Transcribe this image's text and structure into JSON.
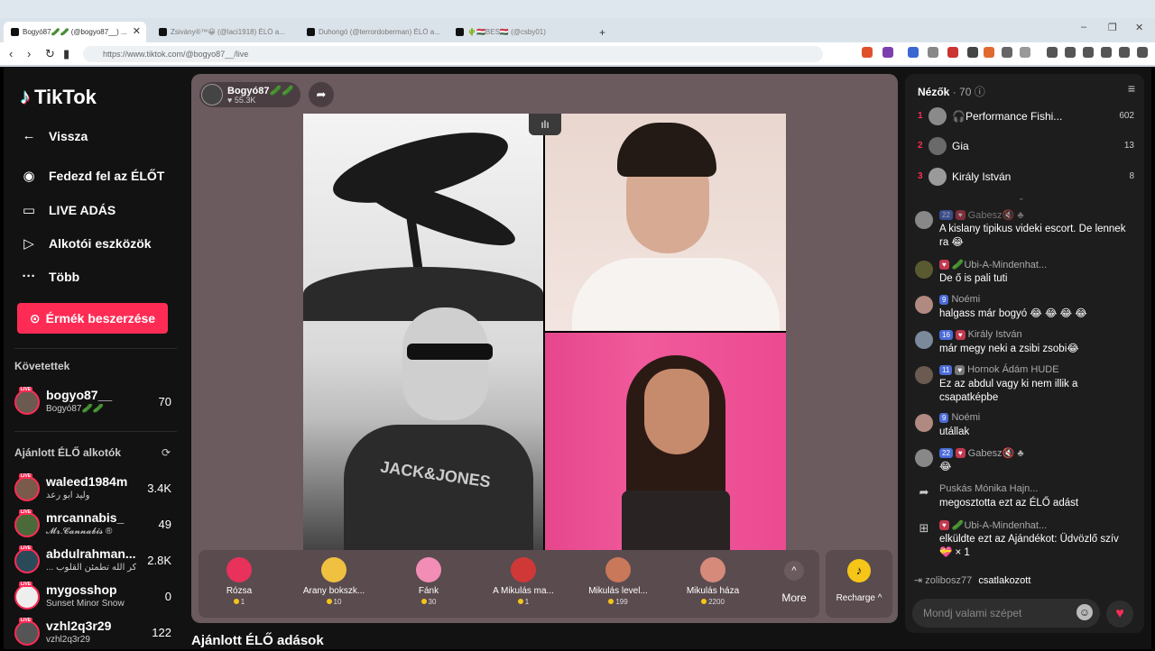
{
  "browser": {
    "tabs": [
      {
        "title": "Bogyó87🥒🥒 (@bogyo87__) ..."
      },
      {
        "title": "Zsivány®™😀 (@laci1918) ÉLŐ a..."
      },
      {
        "title": "Duhongó (@terrordoberman) ÉLŐ a..."
      },
      {
        "title": "🌵🇭🇺BES🇭🇺 (@csby01)"
      }
    ],
    "new_tab": "+",
    "url": "https://www.tiktok.com/@bogyo87__/live",
    "window_controls": [
      "–",
      "❐",
      "✕"
    ]
  },
  "sidebar": {
    "logo_text": "TikTok",
    "nav": [
      {
        "label": "Vissza",
        "icon": "←"
      },
      {
        "label": "Fedezd fel az ÉLŐT",
        "icon": "◉"
      },
      {
        "label": "LIVE ADÁS",
        "icon": "▭"
      },
      {
        "label": "Alkotói eszközök",
        "icon": "▷"
      },
      {
        "label": "Több",
        "icon": "···"
      }
    ],
    "buy_button": "Érmék beszerzése",
    "followed_header": "Követettek",
    "followed": [
      {
        "name": "bogyo87__",
        "sub": "Bogyó87🥒🥒",
        "count": "70"
      }
    ],
    "recommended_header": "Ajánlott ÉLŐ alkotók",
    "recommended": [
      {
        "name": "waleed1984m",
        "sub": "وليد ابو رعد",
        "count": "3.4K"
      },
      {
        "name": "mrcannabis_",
        "sub": "𝓜𝓻.𝓒𝓪𝓷𝓷𝓪𝓫𝓲𝓼 ®",
        "count": "49"
      },
      {
        "name": "abdulrahman...",
        "sub": "... الا بذكر الله تطمئن القلوب",
        "count": "2.8K"
      },
      {
        "name": "mygosshop",
        "sub": "Sunset Minor Snow",
        "count": "0"
      },
      {
        "name": "vzhl2q3r29",
        "sub": "vzhl2q3r29",
        "count": "122"
      }
    ],
    "live_badge": "LIVE"
  },
  "main": {
    "bottom_heading": "Ajánlott ÉLŐ adások",
    "host": {
      "name": "Bogyó87🥒🥒",
      "likes": "♥ 55.3K"
    },
    "shirt_text": "JACK&JONES",
    "eq_icon": "ılı",
    "gifts": [
      {
        "name": "Rózsa",
        "price": "1",
        "color": "#e8315b"
      },
      {
        "name": "Arany bokszk...",
        "price": "10",
        "color": "#f0c040"
      },
      {
        "name": "Fánk",
        "price": "30",
        "color": "#f28db5"
      },
      {
        "name": "A Mikulás ma...",
        "price": "1",
        "color": "#d03838"
      },
      {
        "name": "Mikulás level...",
        "price": "199",
        "color": "#c9785a"
      },
      {
        "name": "Mikulás háza",
        "price": "2200",
        "color": "#d68a7a"
      }
    ],
    "more_label": "More",
    "more_icon": "^",
    "recharge_label": "Recharge ^",
    "recharge_icon": "♪"
  },
  "chat": {
    "viewers_label": "Nézők",
    "viewers_count": "· 70",
    "top_viewers": [
      {
        "rank": "1",
        "name": "🎧Performance Fishi...",
        "score": "602"
      },
      {
        "rank": "2",
        "name": "Gia",
        "score": "13"
      },
      {
        "rank": "3",
        "name": "Király István",
        "score": "8"
      }
    ],
    "messages": [
      {
        "badges": [
          {
            "t": "22",
            "c": "blue"
          },
          {
            "t": "♥",
            "c": "red"
          }
        ],
        "user": "Gabesz🔇 ♣",
        "text": "A kislany tipikus videki escort. De lennek ra 😂"
      },
      {
        "badges": [
          {
            "t": "♥",
            "c": "red"
          }
        ],
        "user": "🥒Ubi-A-Mindenhat...",
        "text": "De ő is pali tuti"
      },
      {
        "badges": [
          {
            "t": "9",
            "c": "blue"
          }
        ],
        "user": "Noémi",
        "text": "halgass már bogyó 😂 😂 😂 😂"
      },
      {
        "badges": [
          {
            "t": "16",
            "c": "blue"
          },
          {
            "t": "♥",
            "c": "red"
          }
        ],
        "user": "Király István",
        "text": "már megy neki a zsibi zsobi😂"
      },
      {
        "badges": [
          {
            "t": "11",
            "c": "blue"
          },
          {
            "t": "♥",
            "c": "red"
          }
        ],
        "user": "Hornok Ádám HUDE",
        "text": "Ez az abdul vagy ki nem illik a csapatképbe"
      },
      {
        "badges": [
          {
            "t": "9",
            "c": "blue"
          }
        ],
        "user": "Noémi",
        "text": "utállak"
      },
      {
        "badges": [
          {
            "t": "22",
            "c": "blue"
          },
          {
            "t": "♥",
            "c": "red"
          }
        ],
        "user": "Gabesz🔇 ♣",
        "text": "😂"
      }
    ],
    "share_event": {
      "user": "Puskás Mónika Hajn...",
      "text": "megosztotta ezt az ÉLŐ adást"
    },
    "gift_event": {
      "user": "🥒Ubi-A-Mindenhat...",
      "text": "elküldte ezt az Ajándékot: Üdvözlő szív 💝 × 1"
    },
    "joined": {
      "user": "zolibosz77",
      "text": "csatlakozott"
    },
    "input_placeholder": "Mondj valami szépet",
    "chevron": "⌄"
  }
}
